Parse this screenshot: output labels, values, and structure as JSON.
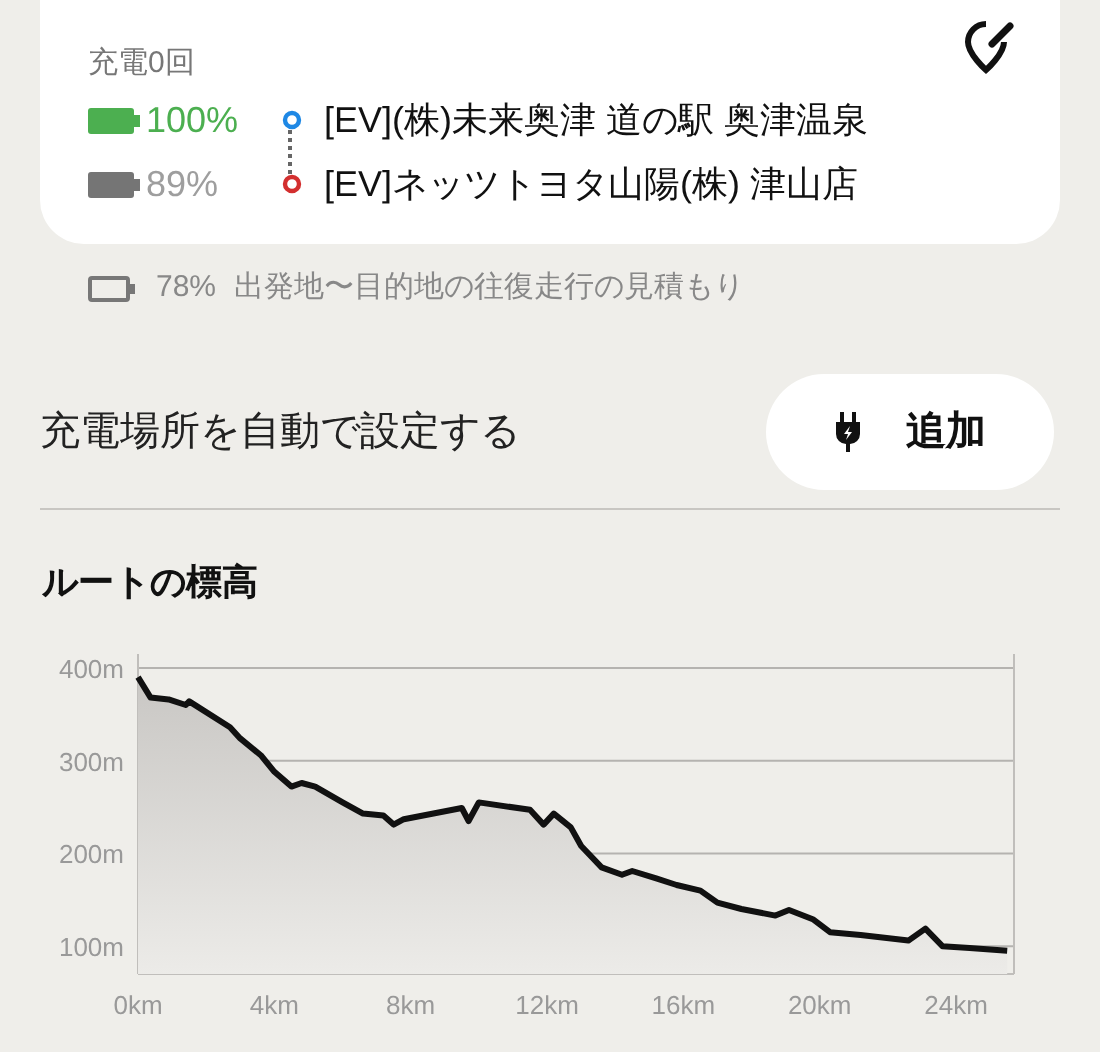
{
  "route_card": {
    "charge_count": "充電0回",
    "stops": [
      {
        "kind": "origin",
        "color": "#4caf50",
        "battery": "100%",
        "name": "[EV](株)未来奥津 道の駅 奥津温泉"
      },
      {
        "kind": "destination",
        "color": "#757575",
        "battery": "89%",
        "name": "[EV]ネッツトヨタ山陽(株) 津山店"
      }
    ]
  },
  "round_trip": {
    "battery": "78%",
    "text": "出発地〜目的地の往復走行の見積もり"
  },
  "auto_charge": {
    "label": "充電場所を自動で設定する",
    "button": "追加"
  },
  "elevation": {
    "title": "ルートの標高",
    "chart_data": {
      "type": "area",
      "x": [
        0,
        0.37,
        0.9,
        1.4,
        1.5,
        2.7,
        3.0,
        3.6,
        4.0,
        4.5,
        4.8,
        5.2,
        6.0,
        6.6,
        7.2,
        7.5,
        7.8,
        9.5,
        9.7,
        10.0,
        11.5,
        11.9,
        12.2,
        12.7,
        13.0,
        13.6,
        14.2,
        14.5,
        15.2,
        15.8,
        16.5,
        17.0,
        17.7,
        18.7,
        19.1,
        19.8,
        20.3,
        21.2,
        22.6,
        23.1,
        23.6,
        24.4,
        25.5
      ],
      "grid": true,
      "series": [
        {
          "color": "#111111",
          "values": [
            390,
            368,
            366,
            360,
            364,
            336,
            324,
            306,
            288,
            272,
            276,
            272,
            255,
            243,
            241,
            231,
            237,
            249,
            235,
            255,
            247,
            231,
            243,
            228,
            208,
            185,
            177,
            181,
            173,
            166,
            160,
            147,
            140,
            133,
            139,
            129,
            115,
            112,
            106,
            119,
            100,
            98,
            95
          ]
        }
      ],
      "xlim": [
        0,
        25.7
      ],
      "ylim": [
        70,
        415
      ],
      "xticks": [
        {
          "value": 0,
          "label": "0km"
        },
        {
          "value": 4,
          "label": "4km"
        },
        {
          "value": 8,
          "label": "8km"
        },
        {
          "value": 12,
          "label": "12km"
        },
        {
          "value": 16,
          "label": "16km"
        },
        {
          "value": 20,
          "label": "20km"
        },
        {
          "value": 24,
          "label": "24km"
        }
      ],
      "yticks": [
        {
          "value": 100,
          "label": "100m"
        },
        {
          "value": 200,
          "label": "200m"
        },
        {
          "value": 300,
          "label": "300m"
        },
        {
          "value": 400,
          "label": "400m"
        }
      ]
    }
  }
}
